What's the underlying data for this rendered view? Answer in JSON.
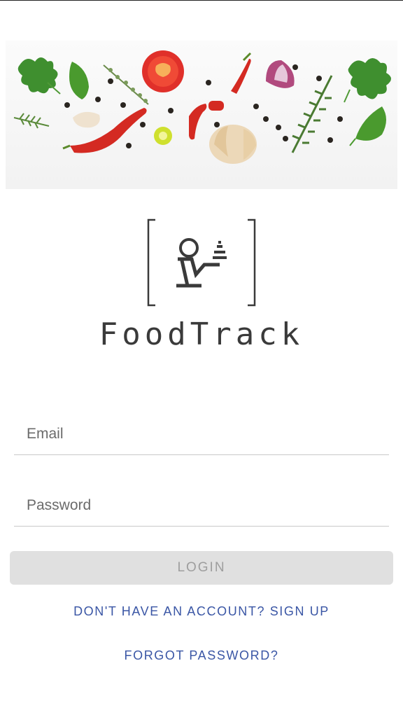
{
  "app": {
    "name": "FoodTrack"
  },
  "form": {
    "email_placeholder": "Email",
    "password_placeholder": "Password",
    "login_label": "LOGIN"
  },
  "links": {
    "signup": "DON'T HAVE AN ACCOUNT? SIGN UP",
    "forgot": "FORGOT PASSWORD?"
  },
  "colors": {
    "link": "#3a56a5",
    "button_bg": "#e0e0e0",
    "button_text": "#9e9e9e",
    "divider": "#c8c8c8"
  },
  "icons": [
    "vegetables-banner-image",
    "waiter-serving-icon"
  ]
}
